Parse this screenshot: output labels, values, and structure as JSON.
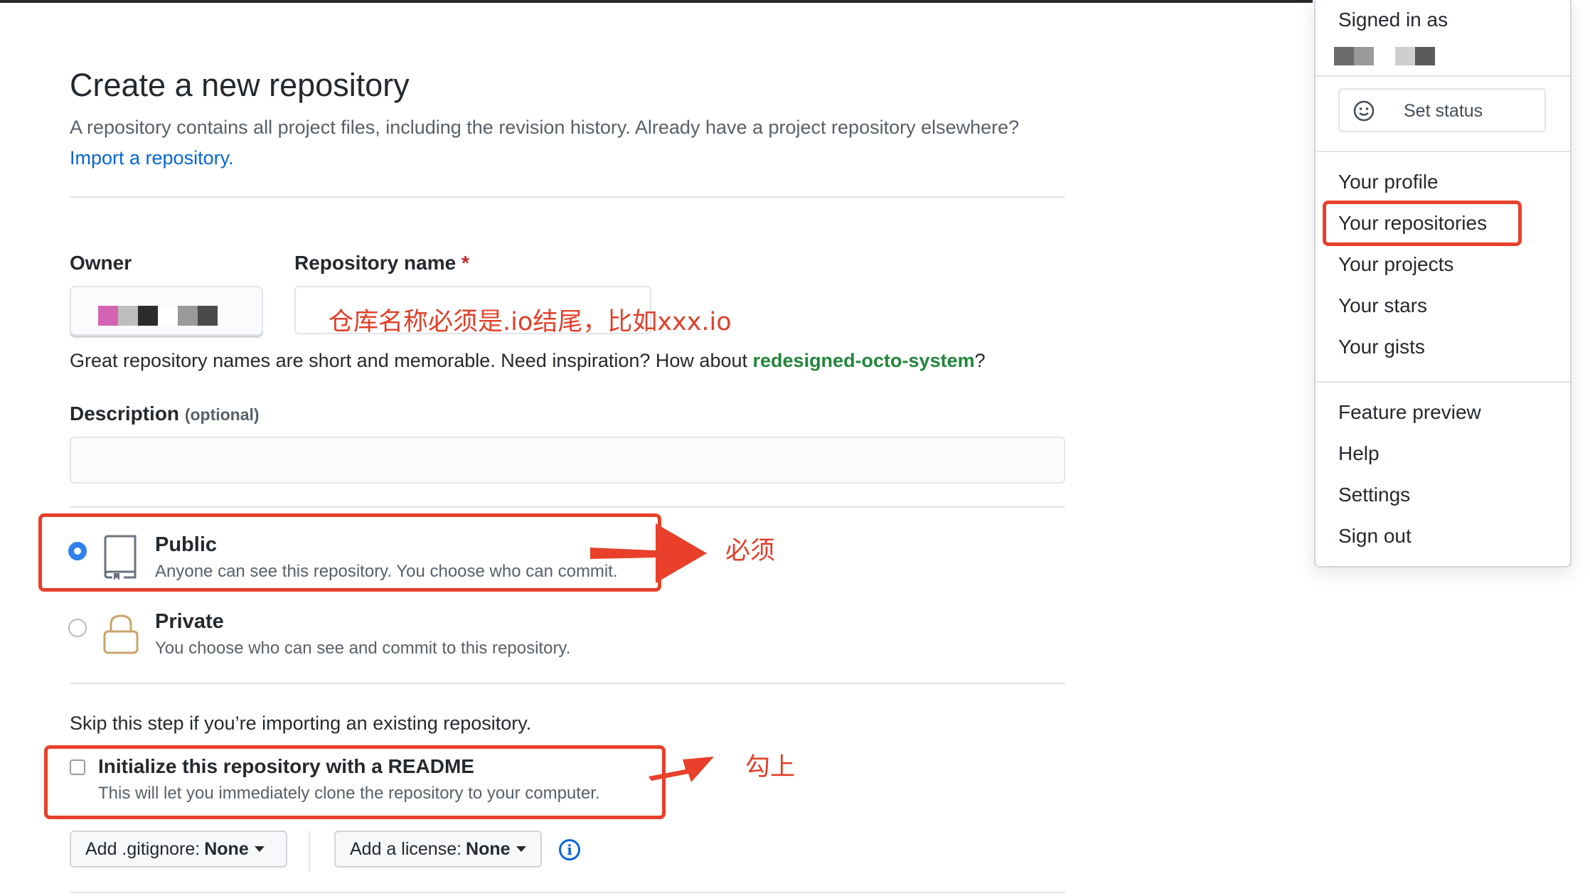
{
  "page": {
    "title": "Create a new repository",
    "subtitle_prefix": "A repository contains all project files, including the revision history. Already have a project repository elsewhere?",
    "import_link": "Import a repository."
  },
  "form": {
    "owner_label": "Owner",
    "repo_name_label": "Repository name",
    "required_mark": "*",
    "repo_name_annotation": "仓库名称必须是.io结尾，比如xxx.io",
    "hint_prefix": "Great repository names are short and memorable. Need inspiration? How about",
    "hint_suggestion": "redesigned-octo-system",
    "hint_suffix": "?",
    "description_label": "Description",
    "description_optional": "(optional)",
    "description_value": ""
  },
  "visibility": {
    "public_title": "Public",
    "public_desc": "Anyone can see this repository. You choose who can commit.",
    "private_title": "Private",
    "private_desc": "You choose who can see and commit to this repository.",
    "selected": "public",
    "annotation": "必须"
  },
  "init": {
    "skip_text": "Skip this step if you’re importing an existing repository.",
    "readme_title": "Initialize this repository with a README",
    "readme_desc": "This will let you immediately clone the repository to your computer.",
    "readme_checked": false,
    "annotation": "勾上",
    "gitignore_prefix": "Add .gitignore:",
    "gitignore_value": "None",
    "license_prefix": "Add a license:",
    "license_value": "None"
  },
  "menu": {
    "signed_in_as": "Signed in as",
    "set_status": "Set status",
    "items_group1": [
      "Your profile",
      "Your repositories",
      "Your projects",
      "Your stars",
      "Your gists"
    ],
    "items_group2": [
      "Feature preview",
      "Help",
      "Settings",
      "Sign out"
    ],
    "highlighted": "Your repositories"
  },
  "colors": {
    "annotation_red": "#e8402a",
    "link_blue": "#0366d6",
    "suggestion_green": "#22863a",
    "radio_blue": "#2f80ed"
  },
  "icons": [
    "repo-icon",
    "lock-icon",
    "smiley-icon",
    "info-icon",
    "caret-down-icon",
    "arrow-right-icon"
  ]
}
